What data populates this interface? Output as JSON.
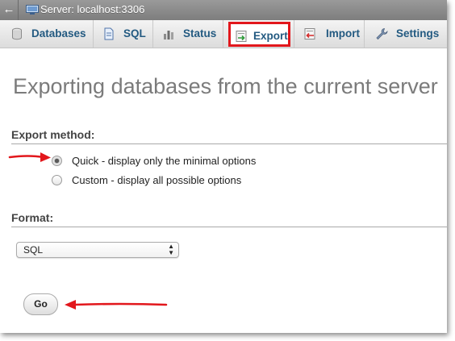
{
  "titlebar": {
    "back_glyph": "←",
    "server_title": "Server: localhost:3306",
    "server_icon": "server-icon"
  },
  "tabs": [
    {
      "label": "Databases",
      "icon": "database-icon",
      "active": false
    },
    {
      "label": "SQL",
      "icon": "sql-document-icon",
      "active": false
    },
    {
      "label": "Status",
      "icon": "status-chart-icon",
      "active": false
    },
    {
      "label": "Export",
      "icon": "export-icon",
      "active": true
    },
    {
      "label": "Import",
      "icon": "import-icon",
      "active": false
    },
    {
      "label": "Settings",
      "icon": "wrench-icon",
      "active": false
    }
  ],
  "page_title": "Exporting databases from the current server",
  "export_method": {
    "header": "Export method:",
    "options": [
      {
        "label": "Quick - display only the minimal options",
        "checked": true
      },
      {
        "label": "Custom - display all possible options",
        "checked": false
      }
    ]
  },
  "format": {
    "header": "Format:",
    "selected": "SQL"
  },
  "go_label": "Go",
  "colors": {
    "tab_label": "#235a81",
    "highlight": "#e2171c",
    "page_title": "#7b7b7b",
    "titlebar": "#8a8a8a"
  }
}
